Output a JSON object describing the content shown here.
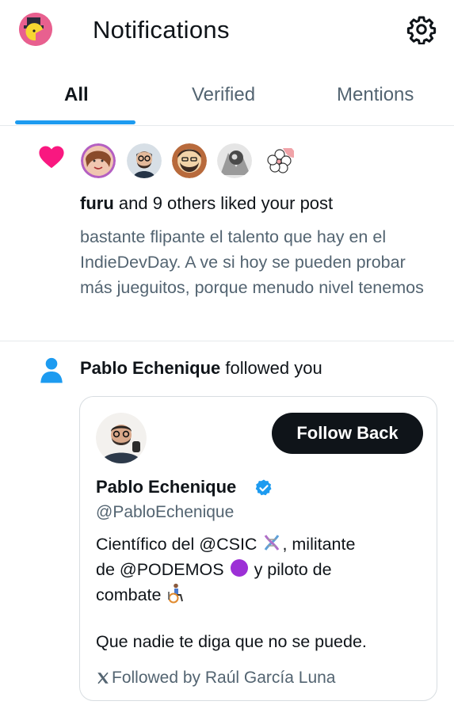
{
  "header": {
    "title": "Notifications",
    "self_avatar_icon": "pacman-top-hat-avatar",
    "settings_icon": "gear-icon"
  },
  "tabs": [
    {
      "label": "All",
      "active": true
    },
    {
      "label": "Verified",
      "active": false
    },
    {
      "label": "Mentions",
      "active": false
    }
  ],
  "accent_color": "#1d9bf0",
  "like_notification": {
    "icon": "heart-icon",
    "icon_color": "#f91880",
    "actor": "furu",
    "text": " and 9 others liked your post",
    "post_snippet": "bastante flipante el talento que hay en el IndieDevDay. A ve si hoy se pueden probar más jueguitos, porque menudo nivel tenemos"
  },
  "follow_notification": {
    "icon": "person-icon",
    "actor": "Pablo Echenique",
    "text": " followed you",
    "card": {
      "button_label": "Follow Back",
      "name": "Pablo Echenique",
      "handle": "@PabloEchenique",
      "bio_line1_pre": "Científico del @CSIC ",
      "bio_line1_post": ", militante",
      "bio_line2_pre": "de @PODEMOS ",
      "bio_line2_post": " y piloto de",
      "bio_line3": "combate ",
      "bio_line4": "Que nadie te diga que no se puede.",
      "followed_by": "Followed by Raúl García Luna"
    }
  }
}
